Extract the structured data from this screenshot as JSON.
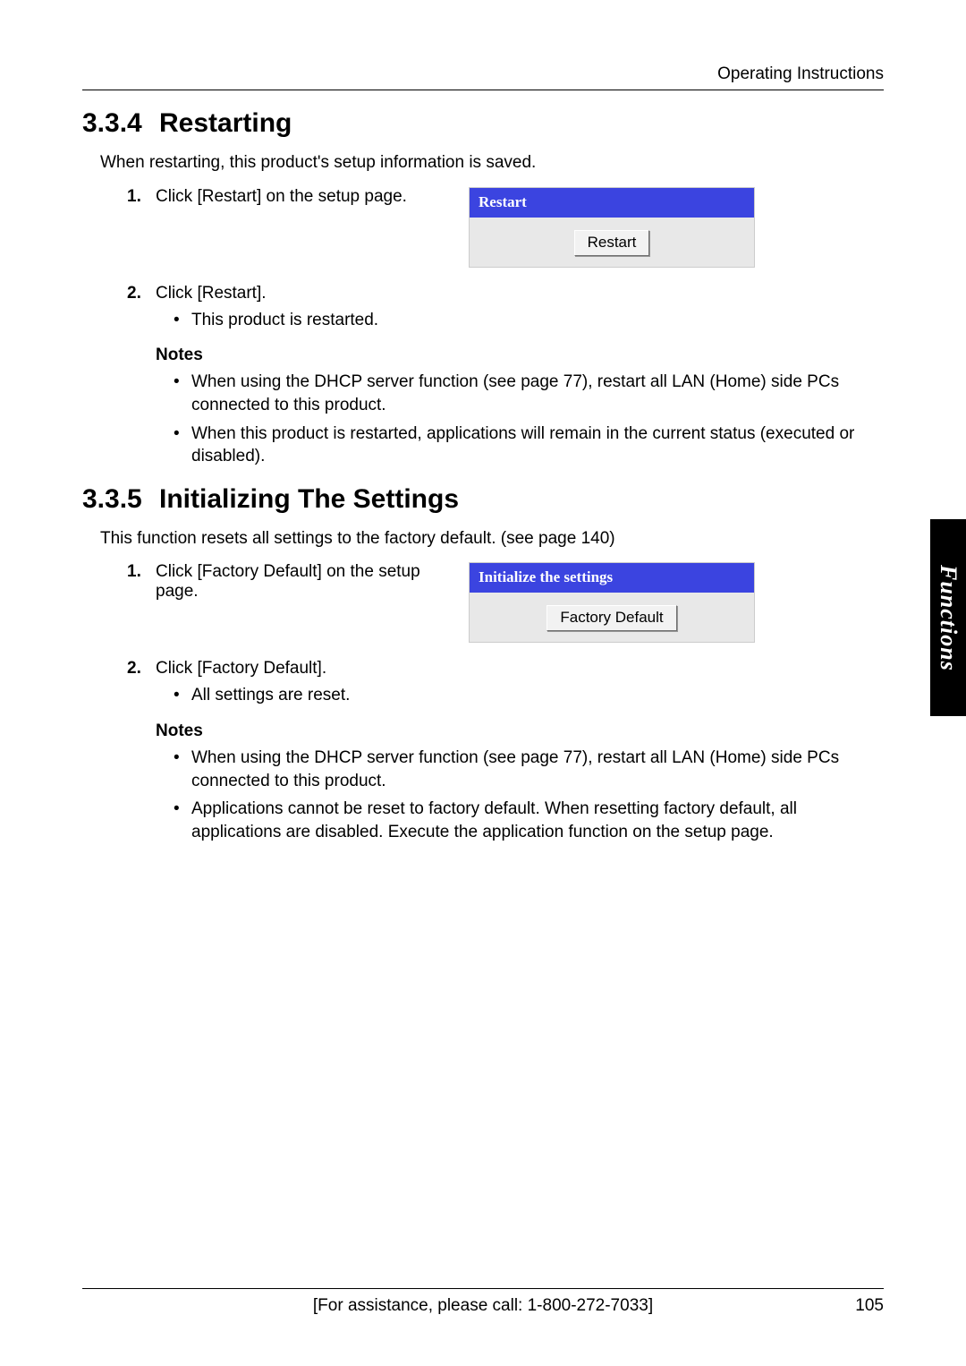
{
  "header": {
    "running": "Operating Instructions"
  },
  "section1": {
    "number": "3.3.4",
    "title": "Restarting",
    "intro": "When restarting, this product's setup information is saved.",
    "step1_num": "1.",
    "step1": "Click [Restart] on the setup page.",
    "panel_title": "Restart",
    "panel_button": "Restart",
    "step2_num": "2.",
    "step2": "Click [Restart].",
    "step2_bullet1": "This product is restarted.",
    "notes_label": "Notes",
    "note1": "When using the DHCP server function (see page 77), restart all LAN (Home) side PCs connected to this product.",
    "note2": "When this product is restarted, applications will remain in the current status (executed or disabled)."
  },
  "section2": {
    "number": "3.3.5",
    "title": "Initializing The Settings",
    "intro": "This function resets all settings to the factory default. (see page 140)",
    "step1_num": "1.",
    "step1": "Click [Factory Default] on the setup page.",
    "panel_title": "Initialize the settings",
    "panel_button": "Factory Default",
    "step2_num": "2.",
    "step2": "Click [Factory Default].",
    "step2_bullet1": "All settings are reset.",
    "notes_label": "Notes",
    "note1": "When using the DHCP server function (see page 77), restart all LAN (Home) side PCs connected to this product.",
    "note2": "Applications cannot be reset to factory default. When resetting factory default, all applications are disabled. Execute the application function on the setup page."
  },
  "side_tab": "Functions",
  "footer": {
    "assist": "[For assistance, please call: 1-800-272-7033]",
    "page": "105"
  }
}
